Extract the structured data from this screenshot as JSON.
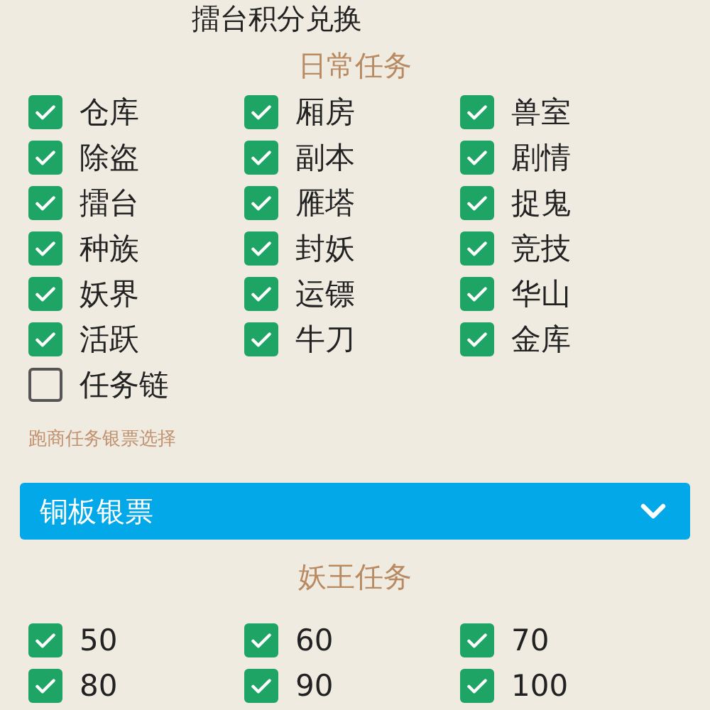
{
  "top_item": {
    "label": "擂台积分兑换"
  },
  "daily_tasks": {
    "title": "日常任务",
    "items": [
      {
        "label": "仓库",
        "checked": true
      },
      {
        "label": "厢房",
        "checked": true
      },
      {
        "label": "兽室",
        "checked": true
      },
      {
        "label": "除盗",
        "checked": true
      },
      {
        "label": "副本",
        "checked": true
      },
      {
        "label": "剧情",
        "checked": true
      },
      {
        "label": "擂台",
        "checked": true
      },
      {
        "label": "雁塔",
        "checked": true
      },
      {
        "label": "捉鬼",
        "checked": true
      },
      {
        "label": "种族",
        "checked": true
      },
      {
        "label": "封妖",
        "checked": true
      },
      {
        "label": "竞技",
        "checked": true
      },
      {
        "label": "妖界",
        "checked": true
      },
      {
        "label": "运镖",
        "checked": true
      },
      {
        "label": "华山",
        "checked": true
      },
      {
        "label": "活跃",
        "checked": true
      },
      {
        "label": "牛刀",
        "checked": true
      },
      {
        "label": "金库",
        "checked": true
      },
      {
        "label": "任务链",
        "checked": false
      }
    ]
  },
  "silver_note": {
    "label": "跑商任务银票选择",
    "value": "铜板银票"
  },
  "demon_king_tasks": {
    "title": "妖王任务",
    "items": [
      {
        "label": "50",
        "checked": true
      },
      {
        "label": "60",
        "checked": true
      },
      {
        "label": "70",
        "checked": true
      },
      {
        "label": "80",
        "checked": true
      },
      {
        "label": "90",
        "checked": true
      },
      {
        "label": "100",
        "checked": true
      }
    ]
  }
}
